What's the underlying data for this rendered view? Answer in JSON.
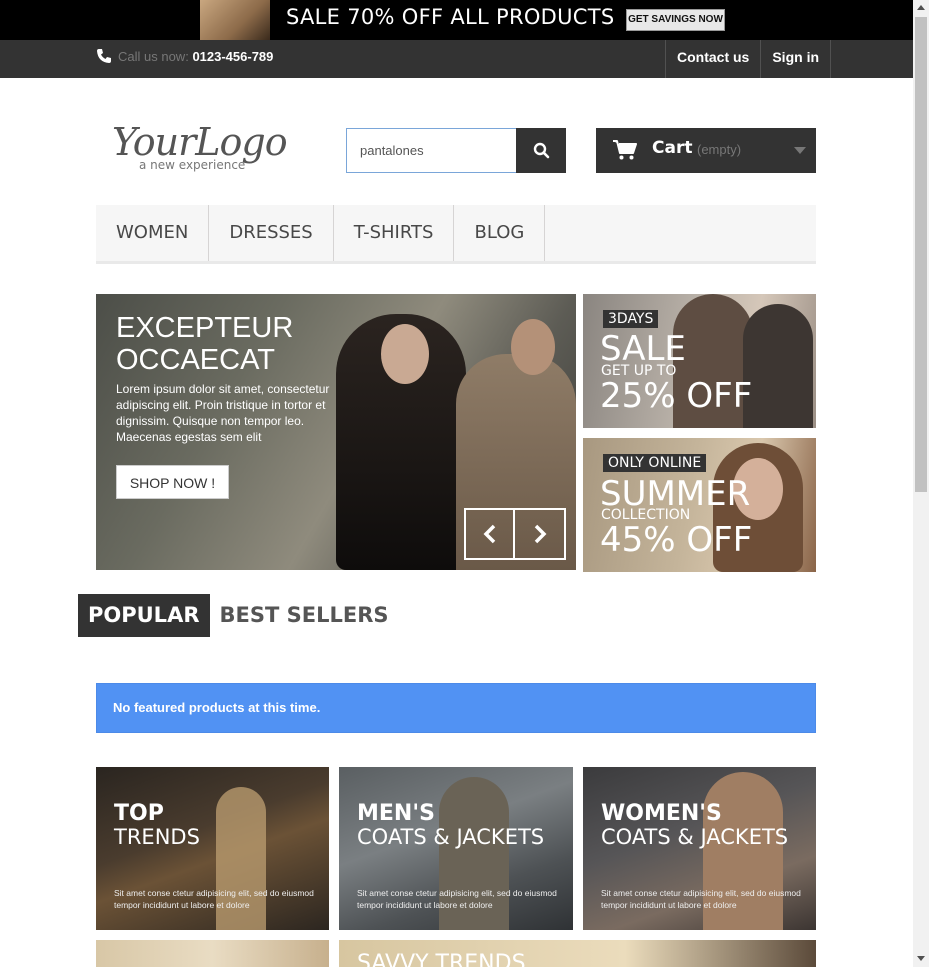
{
  "promo_banner": {
    "text": "SALE 70% OFF ALL PRODUCTS",
    "button": "GET SAVINGS NOW"
  },
  "topbar": {
    "phone_label": "Call us now:",
    "phone_number": "0123-456-789",
    "links": [
      "Contact us",
      "Sign in"
    ]
  },
  "logo": {
    "main": "YourLogo",
    "tagline": "a new experience"
  },
  "search": {
    "value": "pantalones"
  },
  "cart": {
    "label": "Cart",
    "status": "(empty)"
  },
  "menu": [
    "WOMEN",
    "DRESSES",
    "T-SHIRTS",
    "BLOG"
  ],
  "slider": {
    "title": "EXCEPTEUR OCCAECAT",
    "text": "Lorem ipsum dolor sit amet, consectetur adipiscing elit. Proin tristique in tortor et dignissim. Quisque non tempor leo. Maecenas egestas sem elit",
    "button": "SHOP NOW !"
  },
  "side_promos": [
    {
      "tag": "3DAYS",
      "headline": "SALE",
      "sub": "GET UP TO",
      "offer": "25% OFF"
    },
    {
      "tag": "ONLY ONLINE",
      "headline": "SUMMER",
      "sub": "COLLECTION",
      "offer": "45% OFF"
    }
  ],
  "tabs": [
    "POPULAR",
    "BEST SELLERS"
  ],
  "notice": "No featured products at this time.",
  "banners": [
    {
      "title": "TOP",
      "subtitle": "TRENDS",
      "text": "Sit amet conse ctetur adipisicing elit, sed do eiusmod tempor incididunt ut labore et dolore"
    },
    {
      "title": "MEN'S",
      "subtitle": "COATS & JACKETS",
      "text": "Sit amet conse ctetur adipisicing elit, sed do eiusmod tempor incididunt ut labore et dolore"
    },
    {
      "title": "WOMEN'S",
      "subtitle": "COATS & JACKETS",
      "text": "Sit amet conse ctetur adipisicing elit, sed do eiusmod tempor incididunt ut labore et dolore"
    }
  ],
  "bottom_banner": {
    "title": "SAVVY TRENDS"
  }
}
